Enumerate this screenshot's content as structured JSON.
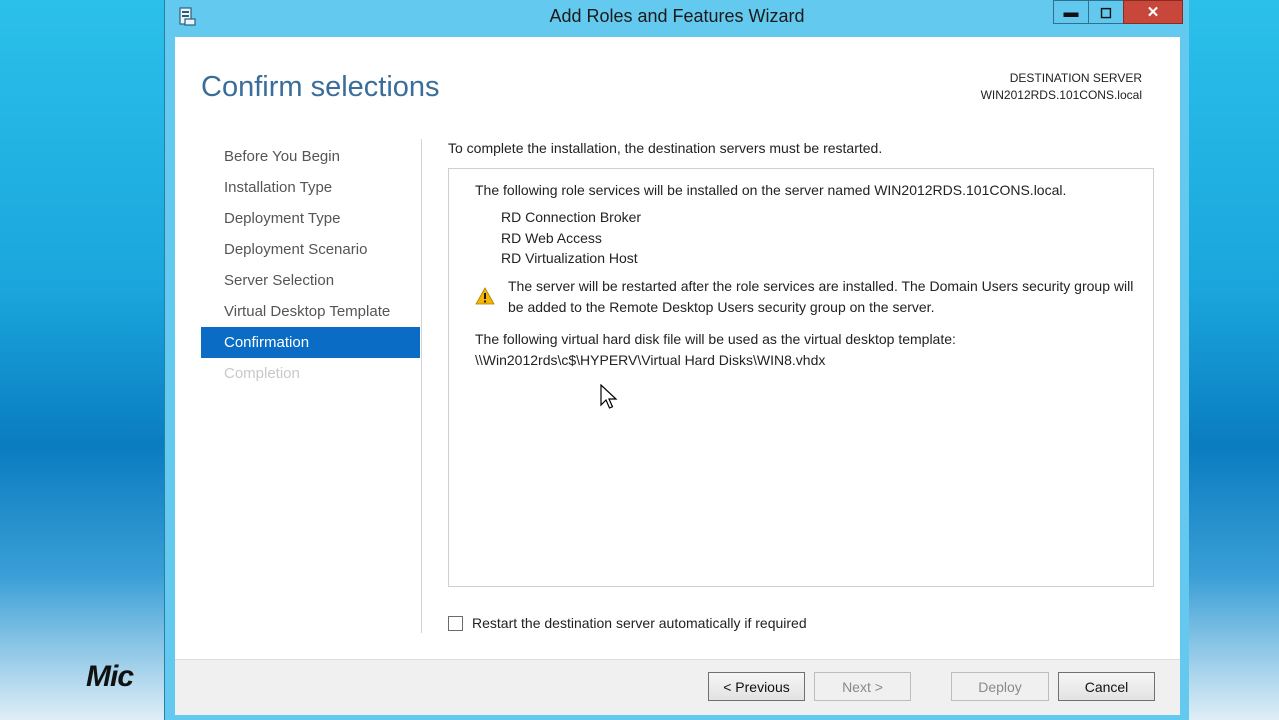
{
  "background": {
    "brand_text": "Mic"
  },
  "window": {
    "title": "Add Roles and Features Wizard",
    "controls": {
      "minimize": "▬",
      "maximize": "◻",
      "close": "✕"
    },
    "icons": {
      "app": "server-manager-icon"
    }
  },
  "header": {
    "page_title": "Confirm selections",
    "destination_label": "DESTINATION SERVER",
    "destination_server": "WIN2012RDS.101CONS.local"
  },
  "nav": {
    "items": [
      {
        "label": "Before You Begin",
        "state": "normal"
      },
      {
        "label": "Installation Type",
        "state": "normal"
      },
      {
        "label": "Deployment Type",
        "state": "normal"
      },
      {
        "label": "Deployment Scenario",
        "state": "normal"
      },
      {
        "label": "Server Selection",
        "state": "normal"
      },
      {
        "label": "Virtual Desktop Template",
        "state": "normal"
      },
      {
        "label": "Confirmation",
        "state": "active"
      },
      {
        "label": "Completion",
        "state": "disabled"
      }
    ]
  },
  "main": {
    "note": "To complete the installation, the destination servers must be restarted.",
    "intro": "The following role services will be installed on the server named WIN2012RDS.101CONS.local.",
    "services": [
      "RD Connection Broker",
      "RD Web Access",
      "RD Virtualization Host"
    ],
    "warning": "The server will be restarted after the role services are installed. The Domain Users security group will be added to the Remote Desktop Users security group on the server.",
    "vhd_intro": "The following virtual hard disk file will be used as the virtual desktop template:",
    "vhd_path": "\\\\Win2012rds\\c$\\HYPERV\\Virtual Hard Disks\\WIN8.vhdx",
    "restart_option": "Restart the destination server automatically if required",
    "restart_checked": false
  },
  "footer": {
    "previous": "< Previous",
    "next": "Next >",
    "deploy": "Deploy",
    "cancel": "Cancel"
  },
  "colors": {
    "accent": "#0a6cc4",
    "title_blue": "#3a6e9a",
    "window_frame": "#63c9ee",
    "close_red": "#c7483a",
    "warning_yellow": "#f2b705"
  }
}
